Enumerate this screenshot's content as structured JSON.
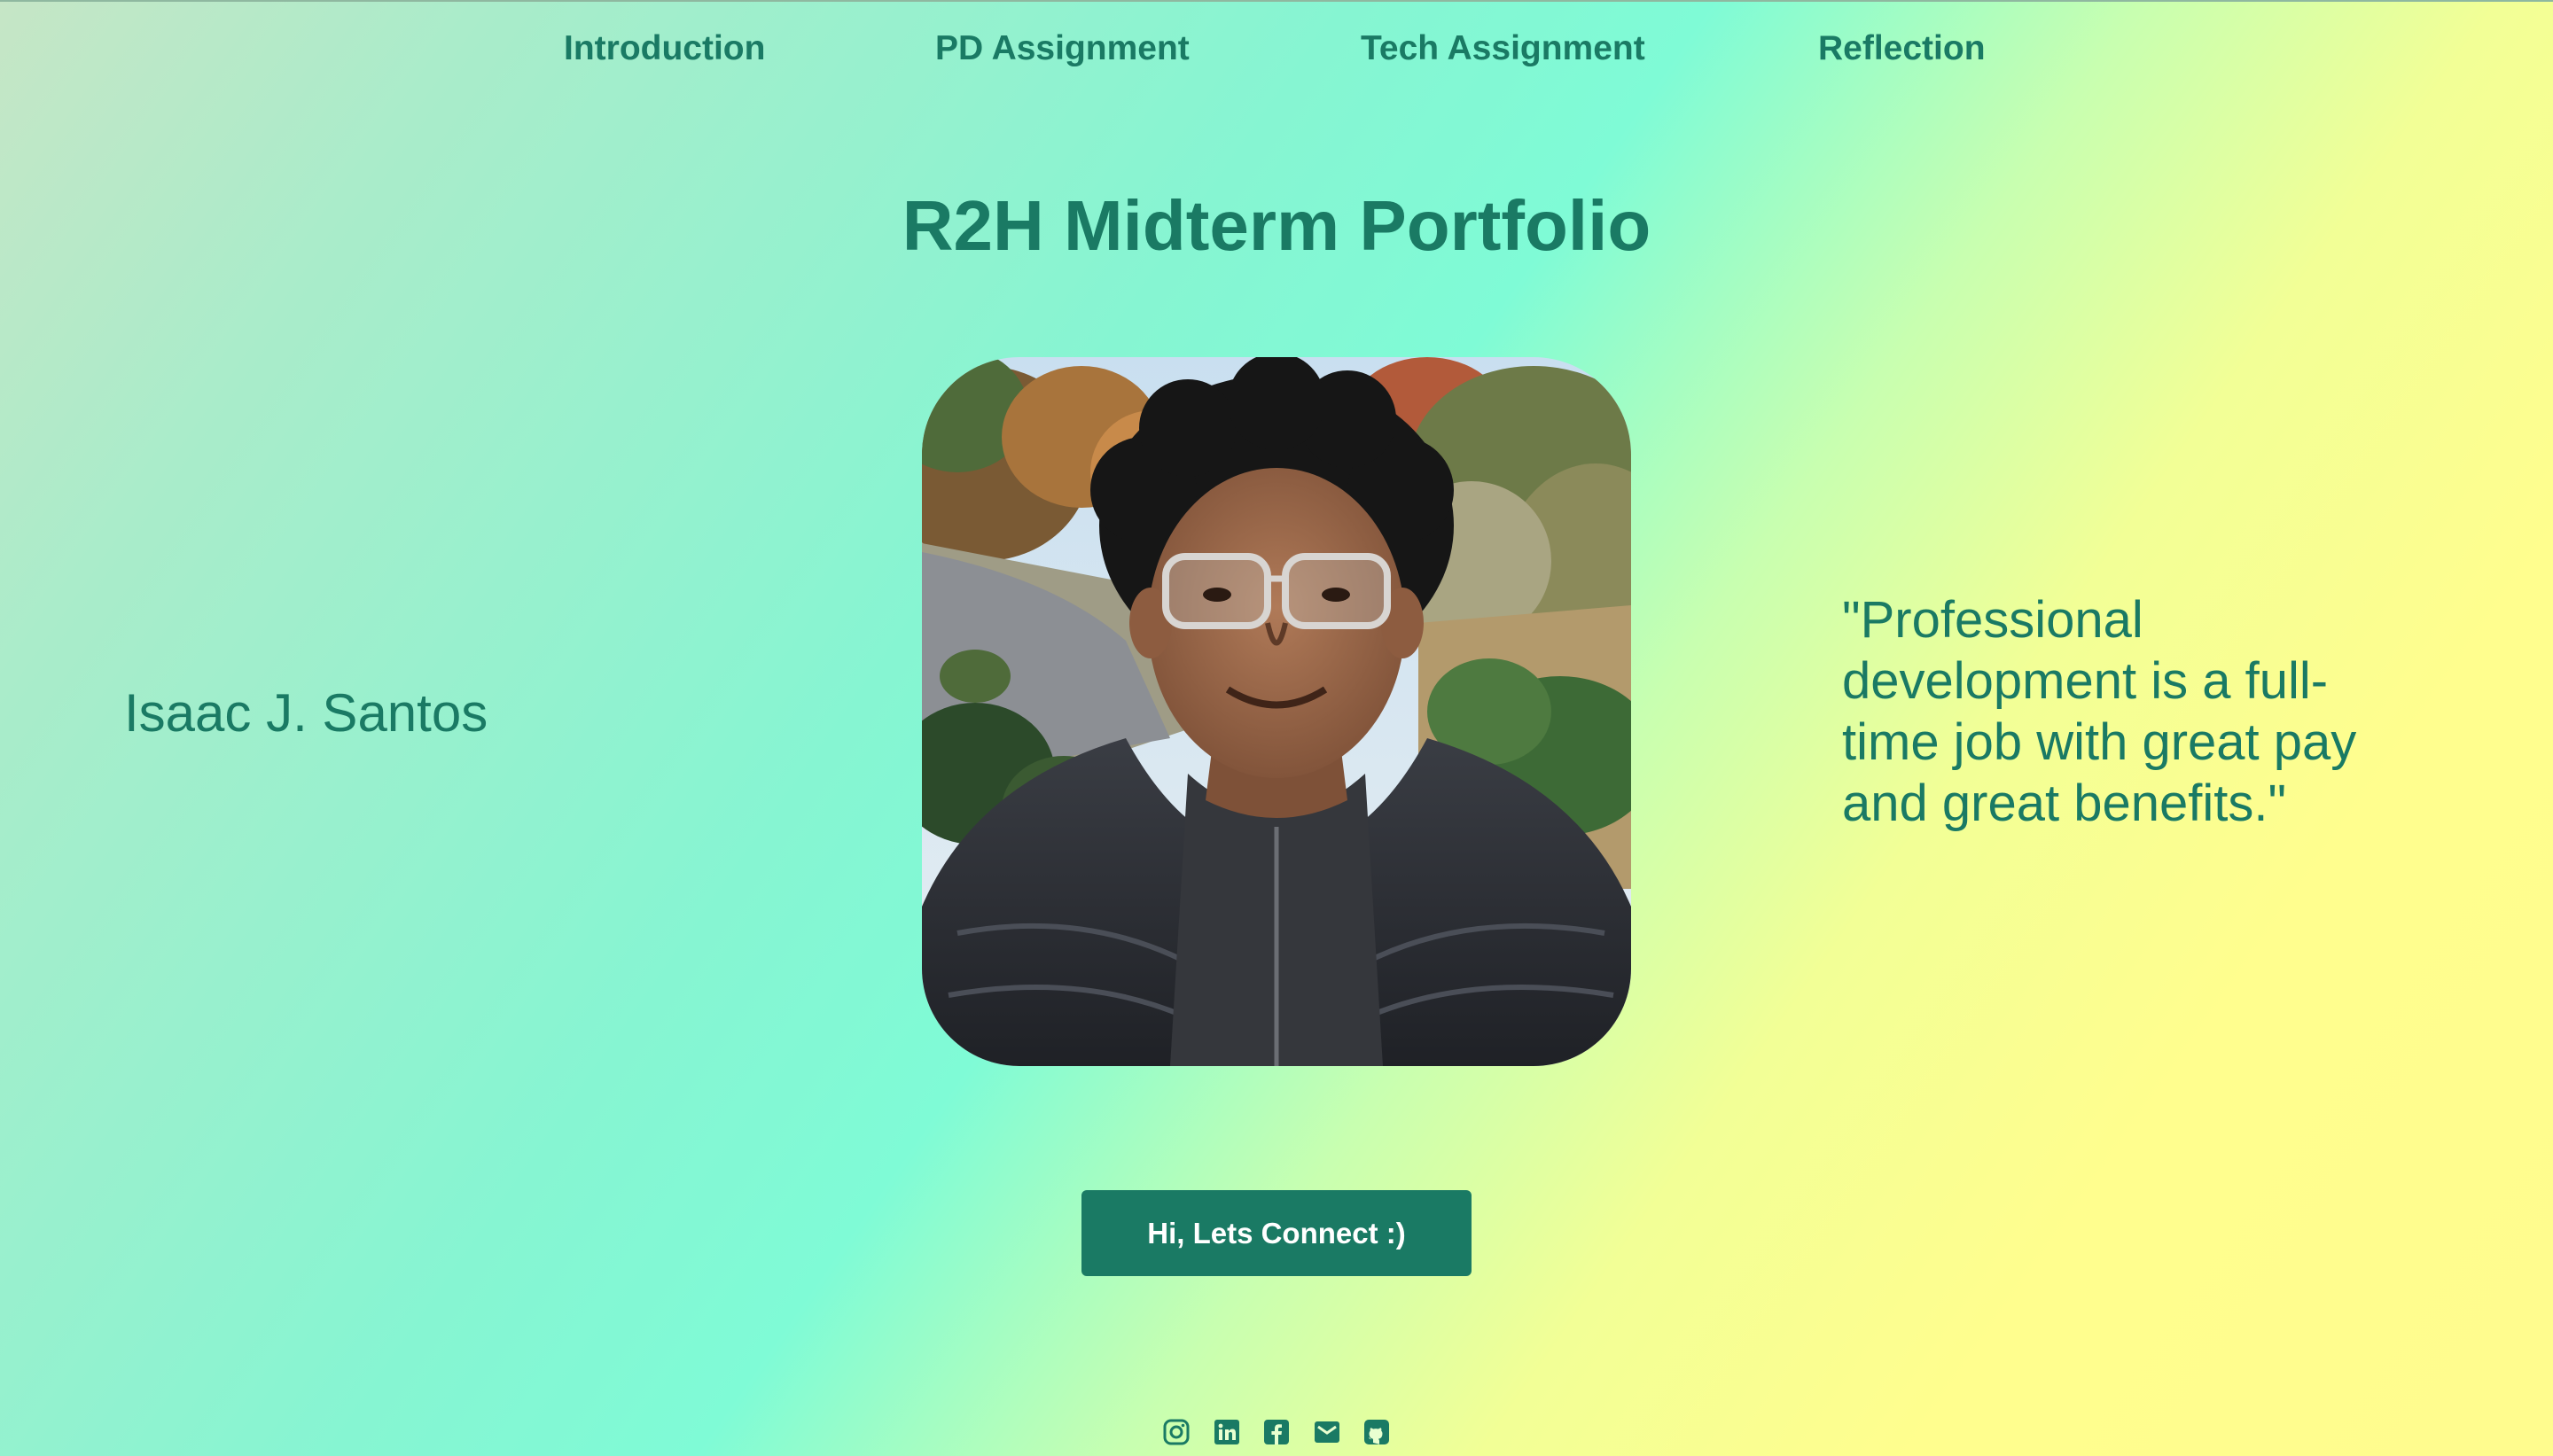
{
  "nav": {
    "items": [
      {
        "label": "Introduction"
      },
      {
        "label": "PD Assignment"
      },
      {
        "label": "Tech Assignment"
      },
      {
        "label": "Reflection"
      }
    ]
  },
  "hero": {
    "title": "R2H Midterm Portfolio",
    "name": "Isaac J. Santos",
    "quote": "\"Professional development is a full-time job with great pay and great benefits.\"",
    "photo_icon": "profile-photo"
  },
  "cta": {
    "label": "Hi, Lets Connect :)"
  },
  "socials": [
    {
      "icon": "instagram-icon"
    },
    {
      "icon": "linkedin-icon"
    },
    {
      "icon": "facebook-icon"
    },
    {
      "icon": "email-icon"
    },
    {
      "icon": "github-icon"
    }
  ],
  "colors": {
    "accent": "#1a7a64",
    "button_text": "#ffffff"
  }
}
